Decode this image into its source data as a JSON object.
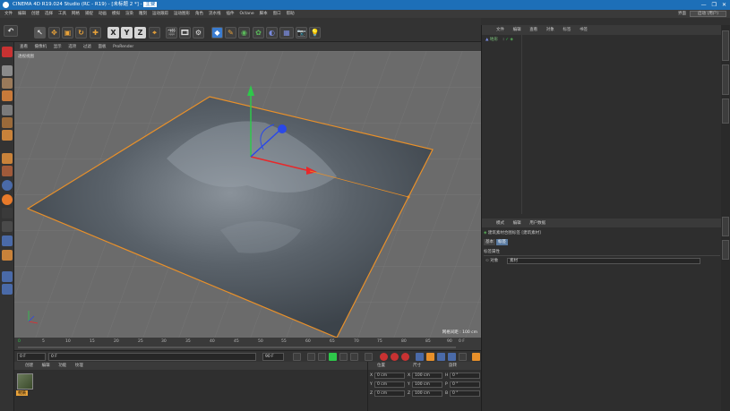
{
  "app": {
    "title_prefix": "CINEMA 4D R19.024 Studio (RC - R19) - [未标题 2 *] - ",
    "title_highlight": "主要",
    "window_controls": [
      "—",
      "❐",
      "✕"
    ]
  },
  "menubar": {
    "items": [
      "文件",
      "编辑",
      "创建",
      "选择",
      "工具",
      "网格",
      "捕捉",
      "动画",
      "模拟",
      "渲染",
      "雕刻",
      "运动跟踪",
      "运动图形",
      "角色",
      "流水线",
      "插件",
      "Octane",
      "脚本",
      "窗口",
      "帮助"
    ],
    "layout_label": "界面",
    "layout_value": "启动 (用户)"
  },
  "toolbar": {
    "axis_x": "X",
    "axis_y": "Y",
    "axis_z": "Z"
  },
  "viewport": {
    "menu": [
      "查看",
      "摄像机",
      "显示",
      "选项",
      "过滤",
      "面板",
      "ProRender"
    ],
    "label": "透视视图",
    "grid_label": "网格间距 : 100 cm"
  },
  "timeline": {
    "ticks": [
      "0",
      "5",
      "10",
      "15",
      "20",
      "25",
      "30",
      "35",
      "40",
      "45",
      "50",
      "55",
      "60",
      "65",
      "70",
      "75",
      "80",
      "85",
      "90"
    ],
    "end_frame": "0 F"
  },
  "playback": {
    "current": "0 F",
    "start": "0 F",
    "end": "90 F",
    "max": "90 F"
  },
  "materials": {
    "menu": [
      "创建",
      "编辑",
      "功能",
      "纹理"
    ],
    "material_name": "材质"
  },
  "coordinates": {
    "headers": [
      "位置",
      "尺寸",
      "旋转"
    ],
    "rows": [
      {
        "axis": "X",
        "pos": "0 cm",
        "size_axis": "X",
        "size": "100 cm",
        "rot_axis": "H",
        "rot": "0 °"
      },
      {
        "axis": "Y",
        "pos": "0 cm",
        "size_axis": "Y",
        "size": "100 cm",
        "rot_axis": "P",
        "rot": "0 °"
      },
      {
        "axis": "Z",
        "pos": "0 cm",
        "size_axis": "Z",
        "size": "100 cm",
        "rot_axis": "B",
        "rot": "0 °"
      }
    ]
  },
  "objects": {
    "menu": [
      "文件",
      "编辑",
      "查看",
      "对象",
      "标签",
      "书签"
    ],
    "object_name": "地形"
  },
  "attributes": {
    "menu": [
      "模式",
      "编辑",
      "用户数据"
    ],
    "title": "建筑素材合图标签 [建筑素材]",
    "tabs": [
      "基本",
      "标签"
    ],
    "section": "标签属性",
    "field_label": "对象",
    "field_value": "素材"
  },
  "colors": {
    "titlebar": "#1d6fb8",
    "accent_orange": "#e8a23a",
    "axis_x": "#e8282a",
    "axis_y": "#2ec84a",
    "axis_z": "#2a48e8"
  }
}
